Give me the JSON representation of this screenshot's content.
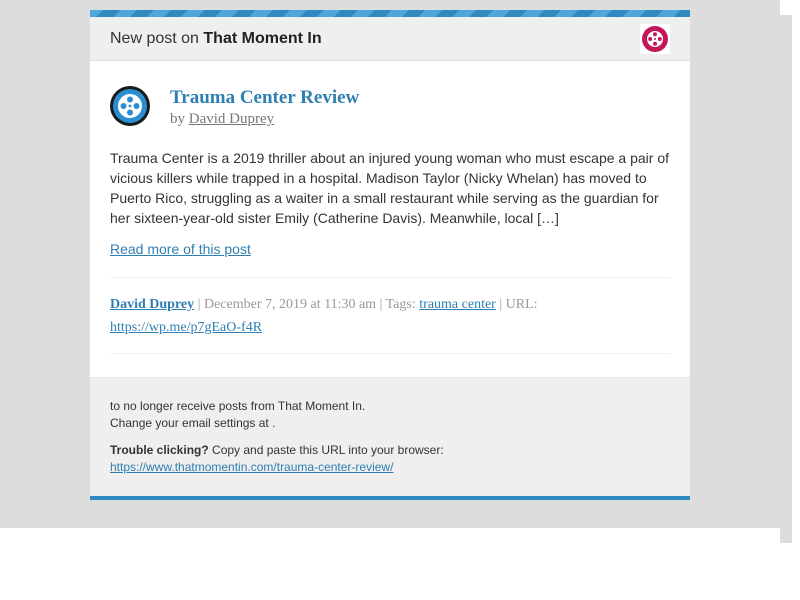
{
  "header": {
    "prefix": "New post on ",
    "site_name": "That Moment In",
    "site_icon": "film-reel-icon"
  },
  "post": {
    "avatar_icon": "film-reel-icon",
    "title": "Trauma Center Review",
    "by_prefix": "by ",
    "author": "David Duprey",
    "excerpt": "Trauma Center is a 2019 thriller about an injured young woman who must escape a pair of vicious killers while trapped in a hospital. Madison Taylor (Nicky Whelan) has moved to Puerto Rico, struggling as a waiter in a small restaurant while serving as the guardian for her sixteen-year-old sister Emily (Catherine Davis). Meanwhile, local […]",
    "read_more": "Read more of this post"
  },
  "meta": {
    "author": "David Duprey",
    "sep1": " | ",
    "date": "December 7, 2019 at 11:30 am",
    "tags_prefix": " | Tags: ",
    "tag": "trauma center",
    "url_prefix": " | URL: ",
    "short_url": "https://wp.me/p7gEaO-f4R"
  },
  "footer": {
    "line1": "to no longer receive posts from That Moment In.",
    "line2": "Change your email settings at .",
    "trouble_bold": "Trouble clicking?",
    "trouble_rest": " Copy and paste this URL into your browser:",
    "full_url": "https://www.thatmomentin.com/trauma-center-review/"
  },
  "colors": {
    "accent": "#2e7fb3",
    "stripe": "#2e8ac1",
    "badge": "#c2185b",
    "background": "#dddddd"
  }
}
